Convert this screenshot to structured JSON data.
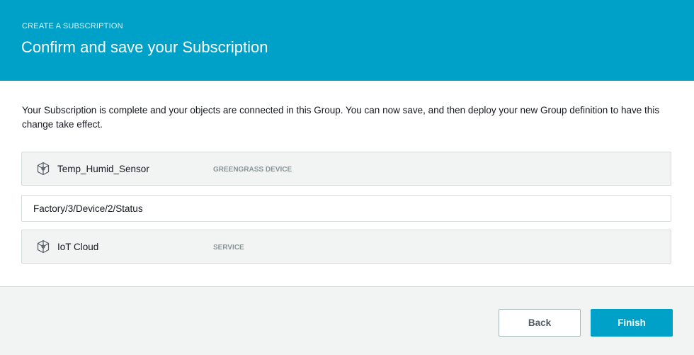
{
  "header": {
    "eyebrow": "CREATE A SUBSCRIPTION",
    "title": "Confirm and save your Subscription"
  },
  "description": "Your Subscription is complete and your objects are connected in this Group. You can now save, and then deploy your new Group definition to have this change take effect.",
  "source": {
    "name": "Temp_Humid_Sensor",
    "type": "GREENGRASS DEVICE",
    "icon": "greengrass-device-icon"
  },
  "topic": {
    "value": "Factory/3/Device/2/Status"
  },
  "target": {
    "name": "IoT Cloud",
    "type": "SERVICE",
    "icon": "iot-service-icon"
  },
  "footer": {
    "back_label": "Back",
    "finish_label": "Finish"
  },
  "colors": {
    "header_bg": "#00a1c9",
    "primary_button": "#00a1c9"
  }
}
